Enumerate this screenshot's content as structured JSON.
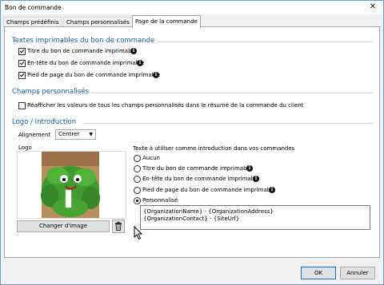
{
  "window": {
    "title": "Bon de commande",
    "close_glyph": "✕"
  },
  "tabs": [
    {
      "label": "Champs prédéfinis",
      "active": false
    },
    {
      "label": "Champs personnalisés",
      "active": false
    },
    {
      "label": "Page de la commande",
      "active": true
    }
  ],
  "printable": {
    "heading": "Textes imprimables du bon de commande",
    "items": [
      {
        "label": "Titre du bon de commande imprimable",
        "checked": true
      },
      {
        "label": "En-tête du bon de commande imprimable",
        "checked": true
      },
      {
        "label": "Pied de page du bon de commande imprimable",
        "checked": true
      }
    ]
  },
  "custom_fields": {
    "heading": "Champs personnalisés",
    "checkbox_label": "Réafficher les valeurs de tous les champs personnalisés dans le résumé de la commande du client",
    "checked": false
  },
  "logo_intro": {
    "heading": "Logo / Introduction",
    "alignment_label": "Alignement",
    "alignment_value": "Centrer",
    "logo_label": "Logo",
    "change_image_label": "Changer d'image",
    "intro_label": "Texte à utiliser comme introduction dans vos commandes",
    "intro_options": [
      {
        "label": "Aucun",
        "selected": false,
        "info": false
      },
      {
        "label": "Titre du bon de commande imprimable",
        "selected": false,
        "info": true
      },
      {
        "label": "En-tête du bon de commande imprimable",
        "selected": false,
        "info": true
      },
      {
        "label": "Pied de page du bon de commande imprimable",
        "selected": false,
        "info": true
      },
      {
        "label": "Personnalisé",
        "selected": true,
        "info": false
      }
    ],
    "custom_text": "{OrganizationName} - {OrganizationAddress}\n{OrganizationContact} - {SiteUrl}"
  },
  "footer": {
    "ok_label": "OK",
    "cancel_label": "Annuler"
  },
  "icons": {
    "info": "info-icon",
    "trash": "trash-icon",
    "cursor": "mouse-cursor-icon"
  },
  "colors": {
    "heading": "#1c5db8",
    "accent_border": "#0078d7"
  }
}
